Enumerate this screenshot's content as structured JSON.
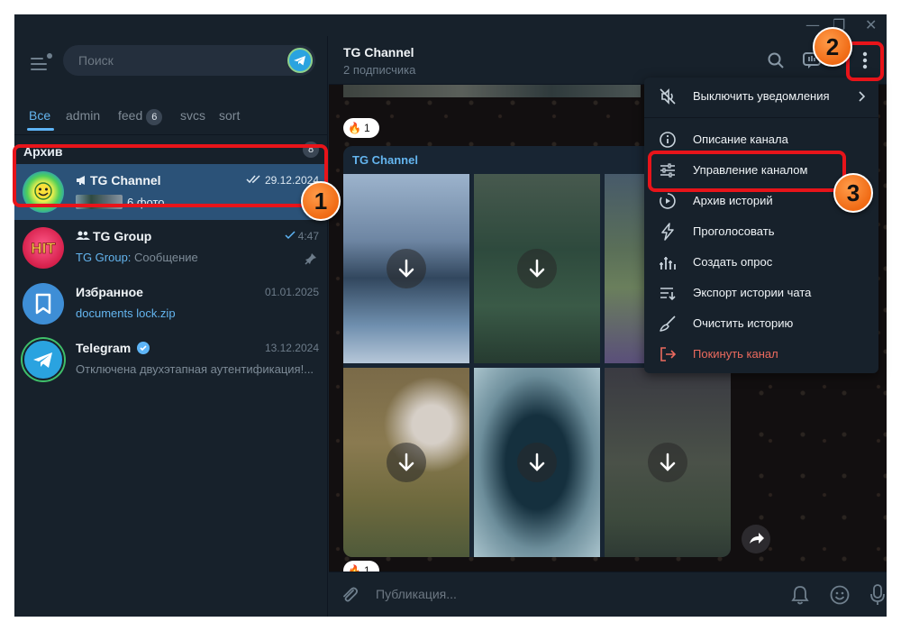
{
  "window": {
    "controls": {
      "minimize": "—",
      "maximize": "❐",
      "close": "✕"
    }
  },
  "search": {
    "placeholder": "Поиск"
  },
  "folders": [
    {
      "label": "Все",
      "active": true
    },
    {
      "label": "admin"
    },
    {
      "label": "feed",
      "badge": "6"
    },
    {
      "label": "svcs"
    },
    {
      "label": "sort"
    }
  ],
  "archive": {
    "title": "Архив",
    "count": "8"
  },
  "chats": [
    {
      "name": "TG Channel",
      "date": "29.12.2024",
      "preview": "6 фото"
    },
    {
      "name": "TG Group",
      "date": "4:47",
      "sender": "TG Group:",
      "preview": " Сообщение"
    },
    {
      "name": "Избранное",
      "date": "01.01.2025",
      "preview": "documents lock.zip"
    },
    {
      "name": "Telegram",
      "date": "13.12.2024",
      "preview": "Отключена двухэтапная аутентификация!..."
    }
  ],
  "channel": {
    "title": "TG Channel",
    "subtitle": "2 подписчика",
    "album_name": "TG Channel",
    "reaction_top": {
      "emoji": "🔥",
      "count": "1"
    },
    "reaction_bottom": {
      "emoji": "🔥",
      "count": "1"
    },
    "composer_placeholder": "Публикация..."
  },
  "menu": {
    "items": [
      {
        "label": "Выключить уведомления",
        "icon": "mute-icon"
      },
      {
        "label": "Описание канала",
        "icon": "info-icon"
      },
      {
        "label": "Управление каналом",
        "icon": "settings-sliders-icon"
      },
      {
        "label": "Архив историй",
        "icon": "stories-archive-icon"
      },
      {
        "label": "Проголосовать",
        "icon": "boost-icon"
      },
      {
        "label": "Создать опрос",
        "icon": "poll-icon"
      },
      {
        "label": "Экспорт истории чата",
        "icon": "export-icon"
      },
      {
        "label": "Очистить историю",
        "icon": "broom-icon"
      },
      {
        "label": "Покинуть канал",
        "icon": "leave-icon",
        "danger": true
      }
    ]
  },
  "annotations": [
    "1",
    "2",
    "3"
  ],
  "colors": {
    "accent": "#5eb5f7",
    "selected": "#2b5278",
    "highlight": "#e8141a",
    "badge": "#f06a14",
    "danger": "#ec6a5e"
  }
}
